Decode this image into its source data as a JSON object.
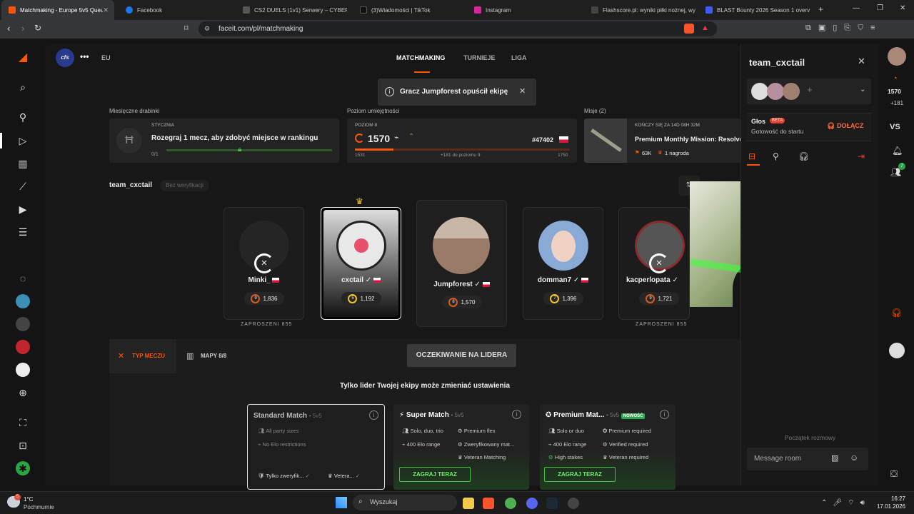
{
  "tabs": [
    {
      "title": "Matchmaking - Europe 5v5 Queue",
      "color": "#ff5500"
    },
    {
      "title": "Facebook",
      "color": "#1877f2"
    },
    {
      "title": "CS2 DUELS (1v1) Serwery – CYBERSHOKE",
      "color": "#555"
    },
    {
      "title": "(3)Wiadomości | TikTok",
      "color": "#111"
    },
    {
      "title": "Instagram",
      "color": "#d6249f"
    },
    {
      "title": "Flashscore.pl: wyniki piłki nożnej, wyniki",
      "color": "#333"
    },
    {
      "title": "BLAST Bounty 2026 Season 1 overview",
      "color": "#3d5afe"
    }
  ],
  "address": {
    "url": "faceit.com/pl/matchmaking"
  },
  "header": {
    "logo": "cfs",
    "region": "EU",
    "nav": [
      "MATCHMAKING",
      "TURNIEJE",
      "LIGA"
    ]
  },
  "toast": {
    "text": "Gracz Jumpforest opuścił ekipę"
  },
  "ranking": {
    "label": "Miesięczne drabinki",
    "month": "STYCZNIA",
    "text": "Rozegraj 1 mecz, aby zdobyć miejsce w rankingu",
    "progress": "0/1"
  },
  "skill": {
    "label": "Poziom umiejętności",
    "level": "POZIOM 8",
    "elo": "1570",
    "rank": "#47402",
    "min": "1531",
    "mid": "+181 do poziomu 9",
    "max": "1750",
    "fill": 0.18
  },
  "missions": {
    "label": "Misje (2)",
    "ends": "KOŃCZY SIĘ ZA 14D 08H 32M",
    "title": "Premium Monthly Mission: Resolve",
    "points": "63K",
    "reward": "1 nagroda"
  },
  "team": {
    "name": "team_cxctail",
    "verify": "Bez weryfikacji"
  },
  "players": [
    {
      "name": "Minki_",
      "level": "9",
      "elo": "1,836",
      "invite": "ZAPROSZENI 855",
      "avatar": "#2a2a2a"
    },
    {
      "name": "cxctail",
      "level": "5",
      "elo": "1,192",
      "avatar": "#c8c8c8"
    },
    {
      "name": "Jumpforest",
      "level": "8",
      "elo": "1,570",
      "avatar": "#9a7a68"
    },
    {
      "name": "domman7",
      "level": "7",
      "elo": "1,396",
      "avatar": "#88aad4"
    },
    {
      "name": "kacperlopata",
      "level": "9",
      "elo": "1,721",
      "invite": "ZAPROSZENI 855",
      "avatar": "#777"
    }
  ],
  "tabs_bottom": {
    "typ": "TYP MECZU",
    "mapy": "MAPY 8/8"
  },
  "waiting": "OCZEKIWANIE NA LIDERA",
  "leader_notice": "Tylko lider Twojej ekipy może zmieniać ustawienia",
  "matches": [
    {
      "title": "Standard Match",
      "suffix": "• 5v5",
      "f": [
        "All party sizes",
        "No Elo restrictions"
      ],
      "b": [
        "Tylko zweryfik...",
        "Vetera..."
      ]
    },
    {
      "title": "Super Match",
      "suffix": "• 5v5",
      "f": [
        "Solo, duo, trio",
        "Premium flex",
        "400 Elo range",
        "Zweryfikowany mat...",
        "Veteran Matching"
      ],
      "btn": "ZAGRAJ TERAZ"
    },
    {
      "title": "Premium Mat...",
      "suffix": "• 5v5",
      "badge": "NOWOŚĆ",
      "f": [
        "Solo or duo",
        "Premium required",
        "400 Elo range",
        "Verified required",
        "High stakes",
        "Veteran required"
      ],
      "btn": "ZAGRAJ TERAZ"
    }
  ],
  "panel": {
    "title": "team_cxctail",
    "voice": "Głos",
    "beta": "BETA",
    "ready": "Gotowość do startu",
    "join": "DOŁĄCZ",
    "start": "Początek rozmowy",
    "placeholder": "Message room"
  },
  "strip": {
    "elo": "1570",
    "diff": "+181",
    "vs": "VS",
    "notif": "7"
  },
  "taskbar": {
    "temp": "1°C",
    "weather": "Pochmurnie",
    "search": "Wyszukaj",
    "time": "16:27",
    "date": "17.01.2026"
  }
}
